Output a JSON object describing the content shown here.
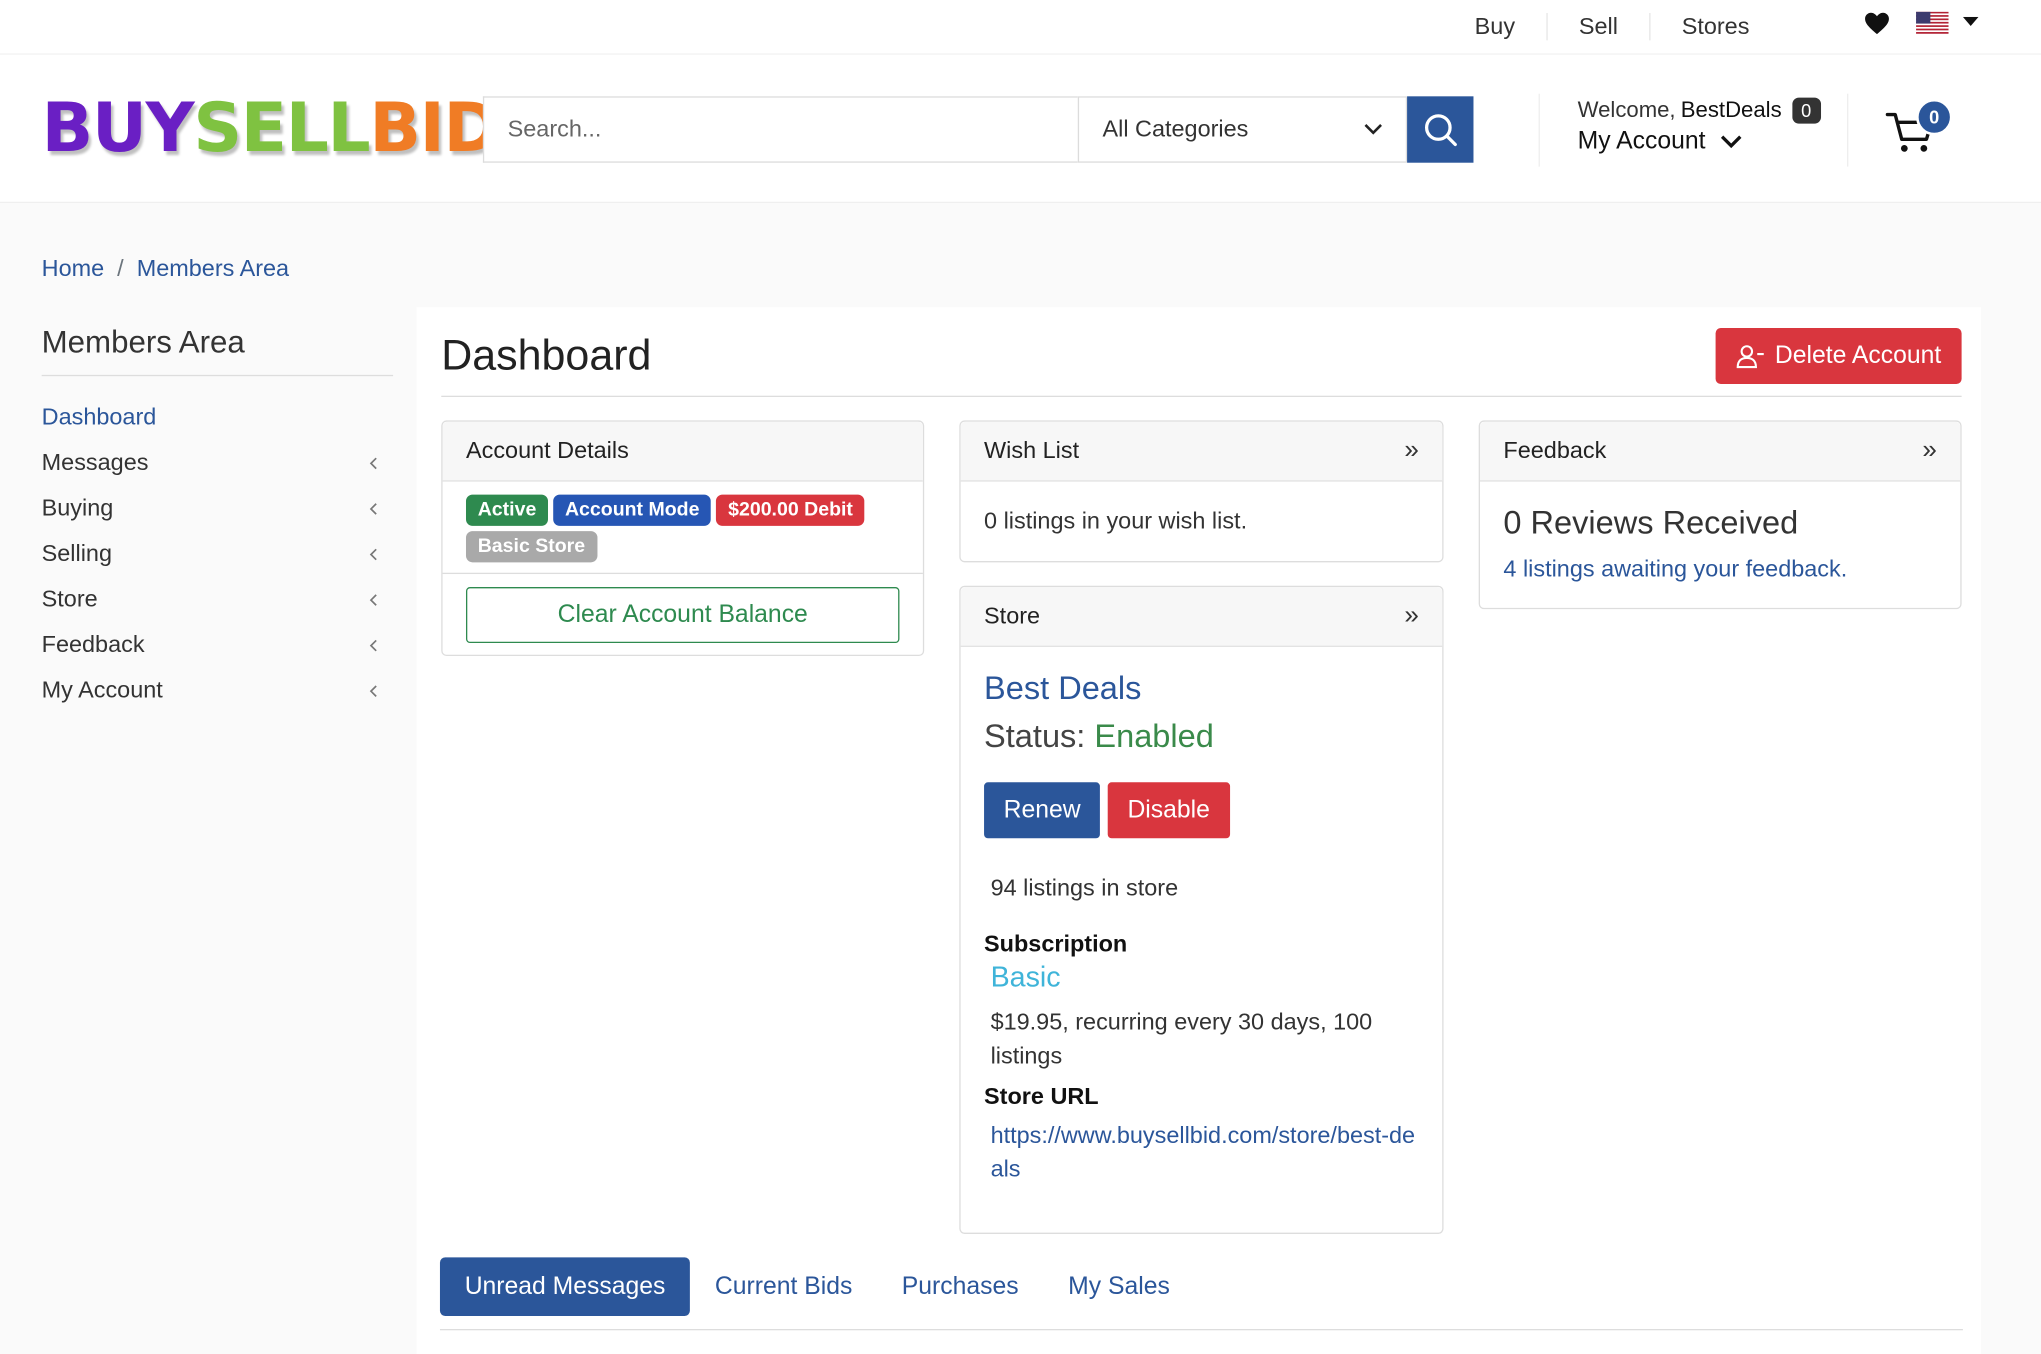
{
  "topbar": {
    "links": [
      "Buy",
      "Sell",
      "Stores"
    ],
    "heart_icon": "heart-icon",
    "flag_icon": "us-flag-icon"
  },
  "header": {
    "logo": {
      "part1": "BUY",
      "part2": "SELL",
      "part3": "BID"
    },
    "search": {
      "placeholder": "Search...",
      "category": "All Categories"
    },
    "account": {
      "welcome": "Welcome,",
      "username": "BestDeals",
      "message_count": "0",
      "my_account": "My Account"
    },
    "cart_count": "0"
  },
  "breadcrumb": {
    "home": "Home",
    "separator": "/",
    "current": "Members Area"
  },
  "sidebar": {
    "title": "Members Area",
    "items": [
      {
        "label": "Dashboard"
      },
      {
        "label": "Messages"
      },
      {
        "label": "Buying"
      },
      {
        "label": "Selling"
      },
      {
        "label": "Store"
      },
      {
        "label": "Feedback"
      },
      {
        "label": "My Account"
      }
    ]
  },
  "main": {
    "title": "Dashboard",
    "delete_button": "Delete Account",
    "account_details": {
      "title": "Account Details",
      "badges": [
        "Active",
        "Account Mode",
        "$200.00 Debit",
        "Basic Store"
      ],
      "clear_button": "Clear Account Balance"
    },
    "wish_list": {
      "title": "Wish List",
      "body": "0 listings in your wish list."
    },
    "store": {
      "title": "Store",
      "name": "Best Deals",
      "status_label": "Status:",
      "status_value": "Enabled",
      "renew_button": "Renew",
      "disable_button": "Disable",
      "listing_count": "94 listings in store",
      "subscription_label": "Subscription",
      "plan": "Basic",
      "price": "$19.95, recurring every 30 days, 100 listings",
      "url_label": "Store URL",
      "url": "https://www.buysellbid.com/store/best-deals"
    },
    "feedback": {
      "title": "Feedback",
      "reviews": "0 Reviews Received",
      "awaiting": "4 listings awaiting your feedback."
    },
    "tabs": [
      "Unread Messages",
      "Current Bids",
      "Purchases",
      "My Sales"
    ]
  },
  "colors": {
    "primary": "#2b569a",
    "danger": "#d9363e",
    "success": "#2e8a4f",
    "info": "#3fb4d9"
  }
}
